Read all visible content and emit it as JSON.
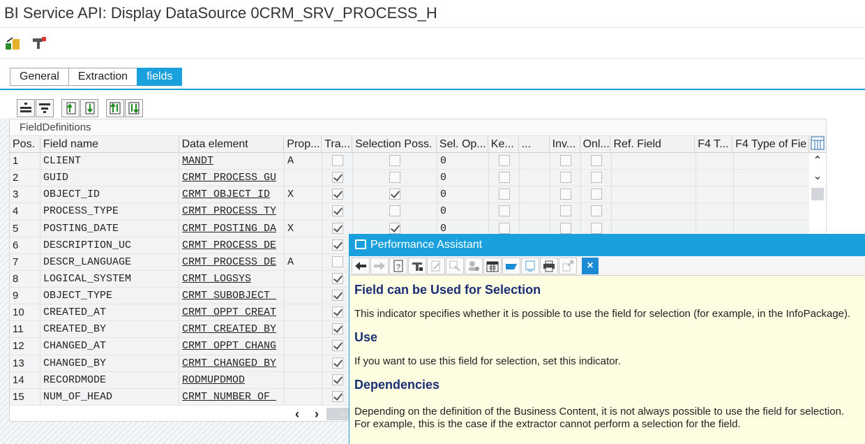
{
  "window": {
    "title": "BI Service API: Display DataSource 0CRM_SRV_PROCESS_H"
  },
  "toolbar": {
    "icons": [
      "hierarchy-icon",
      "display-change-icon"
    ]
  },
  "tabs": [
    {
      "label": "General",
      "active": false
    },
    {
      "label": "Extraction",
      "active": false
    },
    {
      "label": "fields",
      "active": true
    }
  ],
  "table": {
    "title": "FieldDefinitions",
    "columns": [
      "Pos.",
      "Field name",
      "Data element",
      "Prop...",
      "Tra...",
      "Selection Poss.",
      "Sel. Op...",
      "Ke...",
      "...",
      "Inv...",
      "Onl...",
      "Ref. Field",
      "F4 T...",
      "F4 Type of Fie"
    ],
    "rows": [
      {
        "pos": "1",
        "field": "CLIENT",
        "de": "MANDT",
        "prop": "A",
        "tra": false,
        "sel": false,
        "selop": "0"
      },
      {
        "pos": "2",
        "field": "GUID",
        "de": "CRMT_PROCESS_GU",
        "prop": "",
        "tra": true,
        "sel": false,
        "selop": "0"
      },
      {
        "pos": "3",
        "field": "OBJECT_ID",
        "de": "CRMT_OBJECT_ID",
        "prop": "X",
        "tra": true,
        "sel": true,
        "selop": "0"
      },
      {
        "pos": "4",
        "field": "PROCESS_TYPE",
        "de": "CRMT_PROCESS_TY",
        "prop": "",
        "tra": true,
        "sel": false,
        "selop": "0"
      },
      {
        "pos": "5",
        "field": "POSTING_DATE",
        "de": "CRMT_POSTING_DA",
        "prop": "X",
        "tra": true,
        "sel": true,
        "selop": "0"
      },
      {
        "pos": "6",
        "field": "DESCRIPTION_UC",
        "de": "CRMT_PROCESS_DE",
        "prop": "",
        "tra": true
      },
      {
        "pos": "7",
        "field": "DESCR_LANGUAGE",
        "de": "CRMT_PROCESS_DE",
        "prop": "A",
        "tra": false
      },
      {
        "pos": "8",
        "field": "LOGICAL_SYSTEM",
        "de": "CRMT_LOGSYS",
        "prop": "",
        "tra": true
      },
      {
        "pos": "9",
        "field": "OBJECT_TYPE",
        "de": "CRMT_SUBOBJECT_",
        "prop": "",
        "tra": true
      },
      {
        "pos": "10",
        "field": "CREATED_AT",
        "de": "CRMT_OPPT_CREAT",
        "prop": "",
        "tra": true
      },
      {
        "pos": "11",
        "field": "CREATED_BY",
        "de": "CRMT_CREATED_BY",
        "prop": "",
        "tra": true
      },
      {
        "pos": "12",
        "field": "CHANGED_AT",
        "de": "CRMT_OPPT_CHANG",
        "prop": "",
        "tra": true
      },
      {
        "pos": "13",
        "field": "CHANGED_BY",
        "de": "CRMT_CHANGED_BY",
        "prop": "",
        "tra": true
      },
      {
        "pos": "14",
        "field": "RECORDMODE",
        "de": "RODMUPDMOD",
        "prop": "",
        "tra": true
      },
      {
        "pos": "15",
        "field": "NUM_OF_HEAD",
        "de": "CRMT_NUMBER_OF_",
        "prop": "",
        "tra": true
      }
    ]
  },
  "scroll": {
    "h_left": "‹",
    "h_right": "›",
    "v_up": "⌃",
    "v_down": "⌄",
    "h_thumb": "…"
  },
  "assistant": {
    "title": "Performance Assistant",
    "heading": "Field can be Used for Selection",
    "intro": "This indicator specifies whether it is possible to use the field for selection (for example, in the InfoPackage).",
    "use_heading": "Use",
    "use_text": "If you want to use this field for selection, set this indicator.",
    "dep_heading": "Dependencies",
    "dep_text": "Depending on the definition of the Business Content, it is not always possible to use the field for selection. For example, this is the case if the extractor cannot perform a selection for the field.",
    "close_label": "×"
  },
  "colors": {
    "accent": "#1aa0dc",
    "heading": "#1c2e74",
    "popup_bg": "#fdfde2"
  }
}
